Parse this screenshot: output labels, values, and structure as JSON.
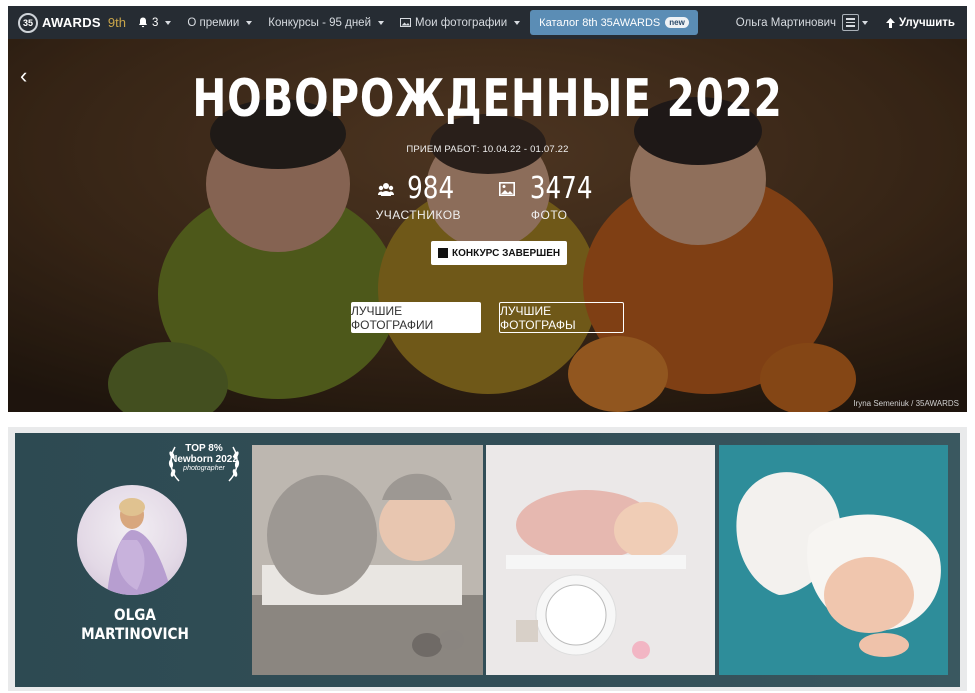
{
  "navbar": {
    "logo_text": "35",
    "brand": "AWARDS",
    "edition": "9th",
    "notifications_count": "3",
    "about": "О премии",
    "contests": "Конкурсы - 95 дней",
    "my_photos": "Мои фотографии",
    "catalog": "Каталог 8th 35AWARDS",
    "catalog_badge": "new",
    "user_name": "Ольга Мартинович",
    "improve": "Улучшить"
  },
  "hero": {
    "title": "НОВОРОЖДЕННЫЕ 2022",
    "dates": "ПРИЕМ РАБОТ: 10.04.22 - 01.07.22",
    "participants_value": "984",
    "participants_label": "УЧАСТНИКОВ",
    "photos_value": "3474",
    "photos_label": "ФОТО",
    "status": "КОНКУРС ЗАВЕРШЕН",
    "best_photos_button": "ЛУЧШИЕ ФОТОГРАФИИ",
    "best_photographers_button": "ЛУЧШИЕ ФОТОГРАФЫ",
    "credit": "Iryna Semeniuk / 35AWARDS"
  },
  "banner": {
    "award_top": "TOP 8%",
    "award_category": "Newborn 2022",
    "award_role": "photographer",
    "photographer": "OLGA MARTINOVICH"
  }
}
